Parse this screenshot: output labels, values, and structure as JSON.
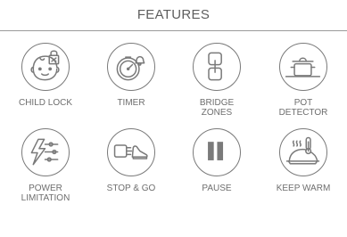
{
  "header": {
    "title": "FEATURES"
  },
  "features": [
    {
      "label": "CHILD LOCK",
      "icon": "child-lock-icon"
    },
    {
      "label": "TIMER",
      "icon": "timer-icon"
    },
    {
      "label": "BRIDGE\nZONES",
      "icon": "bridge-zones-icon"
    },
    {
      "label": "POT\nDETECTOR",
      "icon": "pot-detector-icon"
    },
    {
      "label": "POWER\nLIMITATION",
      "icon": "power-limitation-icon"
    },
    {
      "label": "STOP & GO",
      "icon": "stop-and-go-icon"
    },
    {
      "label": "PAUSE",
      "icon": "pause-icon"
    },
    {
      "label": "KEEP WARM",
      "icon": "keep-warm-icon"
    }
  ],
  "colors": {
    "icon_stroke": "#7a7a7a",
    "text": "#6e6e6e",
    "rule": "#9a9a9a"
  }
}
